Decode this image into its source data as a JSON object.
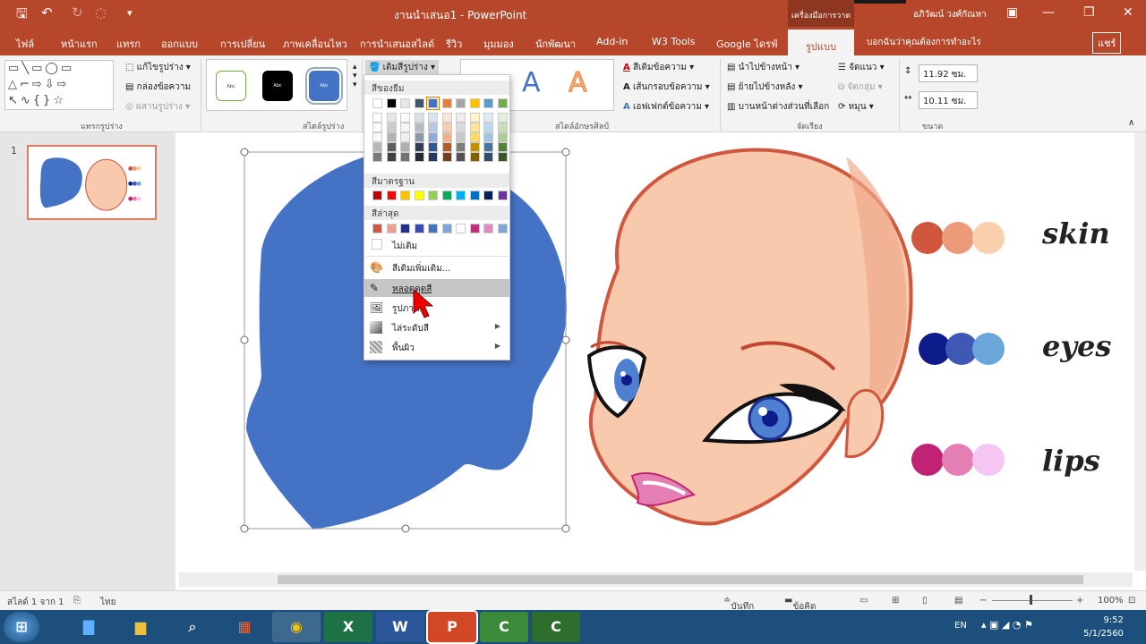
{
  "window": {
    "title": "งานนำเสนอ1 - PowerPoint",
    "context_tab_header": "เครื่องมือการวาด",
    "user": "อภิวัฒน์ วงศ์กัณหา"
  },
  "tabs": [
    "ไฟล์",
    "หน้าแรก",
    "แทรก",
    "ออกแบบ",
    "การเปลี่ยน",
    "ภาพเคลื่อนไหว",
    "การนำเสนอสไลด์",
    "รีวิว",
    "มุมมอง",
    "นักพัฒนา",
    "Add-in",
    "W3 Tools",
    "Google ไดรฟ์",
    "รูปแบบ"
  ],
  "tell_me": "บอกฉันว่าคุณต้องการทำอะไร",
  "share": "แชร์",
  "ribbon": {
    "insert_shapes": {
      "edit_shape": "แก้ไขรูปร่าง",
      "text_box": "กล่องข้อความ",
      "merge_shapes": "ผสานรูปร่าง",
      "label": "แทรกรูปร่าง"
    },
    "shape_styles": {
      "swatch_text": "Abc",
      "label": "สไตล์รูปร่าง",
      "fill_button": "เติมสีรูปร่าง"
    },
    "wordart": {
      "label": "สไตล์อักษรศิลป์",
      "letter": "A",
      "text_fill": "สีเติมข้อความ",
      "text_outline": "เส้นกรอบข้อความ",
      "text_effects": "เอฟเฟกต์ข้อความ"
    },
    "arrange": {
      "bring_forward": "นำไปข้างหน้า",
      "send_backward": "ย้ายไปข้างหลัง",
      "selection_pane": "บานหน้าต่างส่วนที่เลือก",
      "align": "จัดแนว",
      "group": "จัดกลุ่ม",
      "rotate": "หมุน",
      "label": "จัดเรียง"
    },
    "size": {
      "height": "11.92 ซม.",
      "width": "10.11 ซม.",
      "label": "ขนาด"
    }
  },
  "fill_menu": {
    "theme_colors_head": "สีของธีม",
    "standard_colors_head": "สีมาตรฐาน",
    "recent_colors_head": "สีล่าสุด",
    "no_fill": "ไม่เติม",
    "more_colors": "สีเติมเพิ่มเติม...",
    "eyedropper": "หลอดดูดสี",
    "picture": "รูปภาพ...",
    "gradient": "ไล่ระดับสี",
    "texture": "พื้นผิว",
    "theme_top": [
      "#ffffff",
      "#000000",
      "#e7e6e6",
      "#44546a",
      "#4472c4",
      "#ed7d31",
      "#a5a5a5",
      "#ffc000",
      "#5b9bd5",
      "#70ad47"
    ],
    "standard": [
      "#c00000",
      "#ff0000",
      "#ffc000",
      "#ffff00",
      "#92d050",
      "#00b050",
      "#00b0f0",
      "#0070c0",
      "#002060",
      "#7030a0"
    ],
    "recent": [
      "#d0573d",
      "#f0a08a",
      "#22318c",
      "#3a4da8",
      "#4472c4",
      "#7ba7d8",
      "#ffffff",
      "#c03078",
      "#e48ac0",
      "#78a8d8"
    ]
  },
  "slide": {
    "number": "1",
    "legend": [
      {
        "label": "skin",
        "colors": [
          "#d0573d",
          "#eb9a7a",
          "#f9cfae"
        ]
      },
      {
        "label": "eyes",
        "colors": [
          "#0d1c8a",
          "#3f57b5",
          "#6aa6da"
        ]
      },
      {
        "label": "lips",
        "colors": [
          "#c02374",
          "#e47fb4",
          "#f6c6f2"
        ]
      }
    ],
    "shape_fill": "#4472c4"
  },
  "status": {
    "slide_info": "สไลด์ 1 จาก 1",
    "language": "ไทย",
    "notes": "บันทึกย่อ",
    "comments": "ข้อคิดเห็น",
    "zoom": "100%"
  },
  "taskbar": {
    "lang": "EN",
    "time": "9:52",
    "date": "5/1/2560"
  }
}
